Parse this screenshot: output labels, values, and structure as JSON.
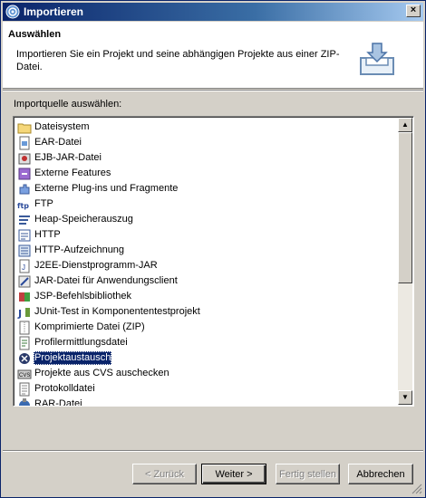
{
  "window": {
    "title": "Importieren"
  },
  "header": {
    "title": "Auswählen",
    "description": "Importieren Sie ein Projekt und seine abhängigen Projekte aus einer ZIP-Datei."
  },
  "list": {
    "label": "Importquelle auswählen:",
    "items": [
      {
        "label": "Dateisystem",
        "icon": "folder-icon"
      },
      {
        "label": "EAR-Datei",
        "icon": "ear-file-icon"
      },
      {
        "label": "EJB-JAR-Datei",
        "icon": "ejb-jar-icon"
      },
      {
        "label": "Externe Features",
        "icon": "feature-icon"
      },
      {
        "label": "Externe Plug-ins und Fragmente",
        "icon": "plugin-icon"
      },
      {
        "label": "FTP",
        "icon": "ftp-icon"
      },
      {
        "label": "Heap-Speicherauszug",
        "icon": "heap-dump-icon"
      },
      {
        "label": "HTTP",
        "icon": "http-icon"
      },
      {
        "label": "HTTP-Aufzeichnung",
        "icon": "http-recording-icon"
      },
      {
        "label": "J2EE-Dienstprogramm-JAR",
        "icon": "jar-icon"
      },
      {
        "label": "JAR-Datei für Anwendungsclient",
        "icon": "app-client-jar-icon"
      },
      {
        "label": "JSP-Befehlsbibliothek",
        "icon": "jsp-taglib-icon"
      },
      {
        "label": "JUnit-Test in Komponententestprojekt",
        "icon": "junit-icon"
      },
      {
        "label": "Komprimierte Datei (ZIP)",
        "icon": "zip-icon"
      },
      {
        "label": "Profilermittlungsdatei",
        "icon": "profile-file-icon"
      },
      {
        "label": "Projektaustausch",
        "icon": "project-interchange-icon",
        "selected": true
      },
      {
        "label": "Projekte aus CVS auschecken",
        "icon": "cvs-icon"
      },
      {
        "label": "Protokolldatei",
        "icon": "log-file-icon"
      },
      {
        "label": "RAR-Datei",
        "icon": "rar-file-icon"
      }
    ]
  },
  "buttons": {
    "back": "< Zurück",
    "next": "Weiter >",
    "finish": "Fertig stellen",
    "cancel": "Abbrechen"
  }
}
